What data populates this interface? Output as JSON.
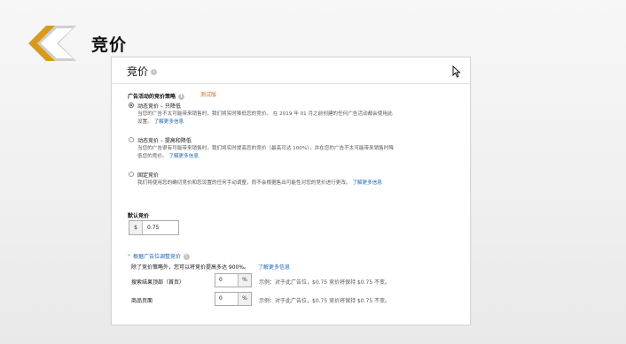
{
  "slide": {
    "title": "竞价"
  },
  "card": {
    "title": "竞价"
  },
  "strategy": {
    "label": "广告活动的竞价策略",
    "beta": "测试版",
    "options": [
      {
        "title": "动态竞价 – 只降低",
        "desc": "当您的广告不太可能带来销售时，我们将实时降低您的竞价。 在 2019 年 01 月之前创建的任何广告活动都会使用此设置。",
        "link": "了解更多信息",
        "selected": true
      },
      {
        "title": "动态竞价 – 提高和降低",
        "desc": "当您的广告很有可能带来销售时，我们将实时提高您的竞价（最高可达 100%），并在您的广告不太可能带来销售时降低您的竞价。",
        "link": "了解更多信息",
        "selected": false
      },
      {
        "title": "固定竞价",
        "desc": "我们将使用您的确切竞价和您设置的任何手动调整，而不会根据售出可能性对您的竞价进行更改。",
        "link": "了解更多信息",
        "selected": false
      }
    ]
  },
  "default_bid": {
    "label": "默认竞价",
    "prefix": "$",
    "value": "0.75"
  },
  "placement": {
    "toggle": "根据广告位调整竞价",
    "note": "除了竞价策略外，您可以将竞价提高多达 900%。",
    "link": "了解更多信息",
    "rows": [
      {
        "label": "搜索结果顶部（首页）",
        "value": "0",
        "suffix": "%",
        "example": "示例：对于此广告位，$0.75 竞价将保持 $0.75 不变。"
      },
      {
        "label": "商品页面",
        "value": "0",
        "suffix": "%",
        "example": "示例：对于此广告位，$0.75 竞价将保持 $0.75 不变。"
      }
    ]
  }
}
